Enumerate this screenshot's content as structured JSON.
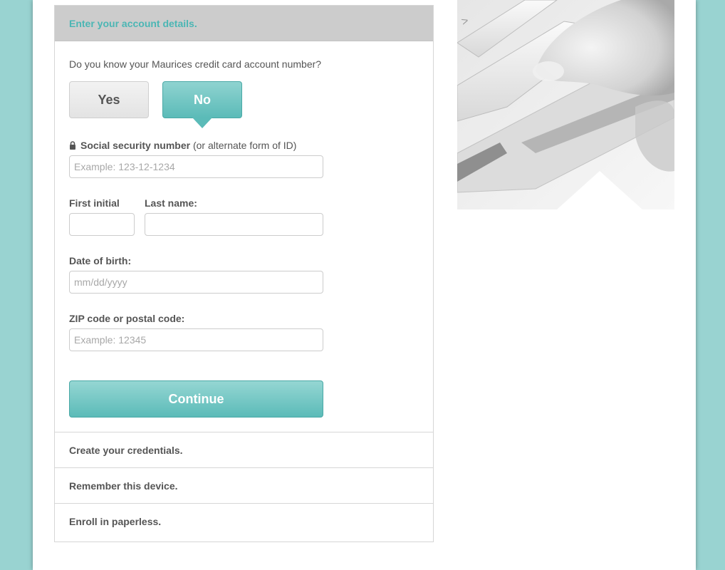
{
  "steps": {
    "active_header": "Enter your account details.",
    "collapsed": [
      "Create your credentials.",
      "Remember this device.",
      "Enroll in paperless."
    ]
  },
  "form": {
    "question": "Do you know your Maurices credit card account number?",
    "yes_label": "Yes",
    "no_label": "No",
    "selected": "No",
    "ssn_label_bold": "Social security number",
    "ssn_label_normal": "(or alternate form of ID)",
    "ssn_placeholder": "Example: 123-12-1234",
    "first_initial_label": "First initial",
    "last_name_label": "Last name:",
    "dob_label": "Date of birth:",
    "dob_placeholder": "mm/dd/yyyy",
    "zip_label": "ZIP code or postal code:",
    "zip_placeholder": "Example: 12345",
    "continue_label": "Continue"
  },
  "colors": {
    "background": "#99d3d1",
    "accent": "#5bbbb8",
    "header_text": "#4bb6b4"
  },
  "icons": {
    "lock": "lock-icon"
  }
}
